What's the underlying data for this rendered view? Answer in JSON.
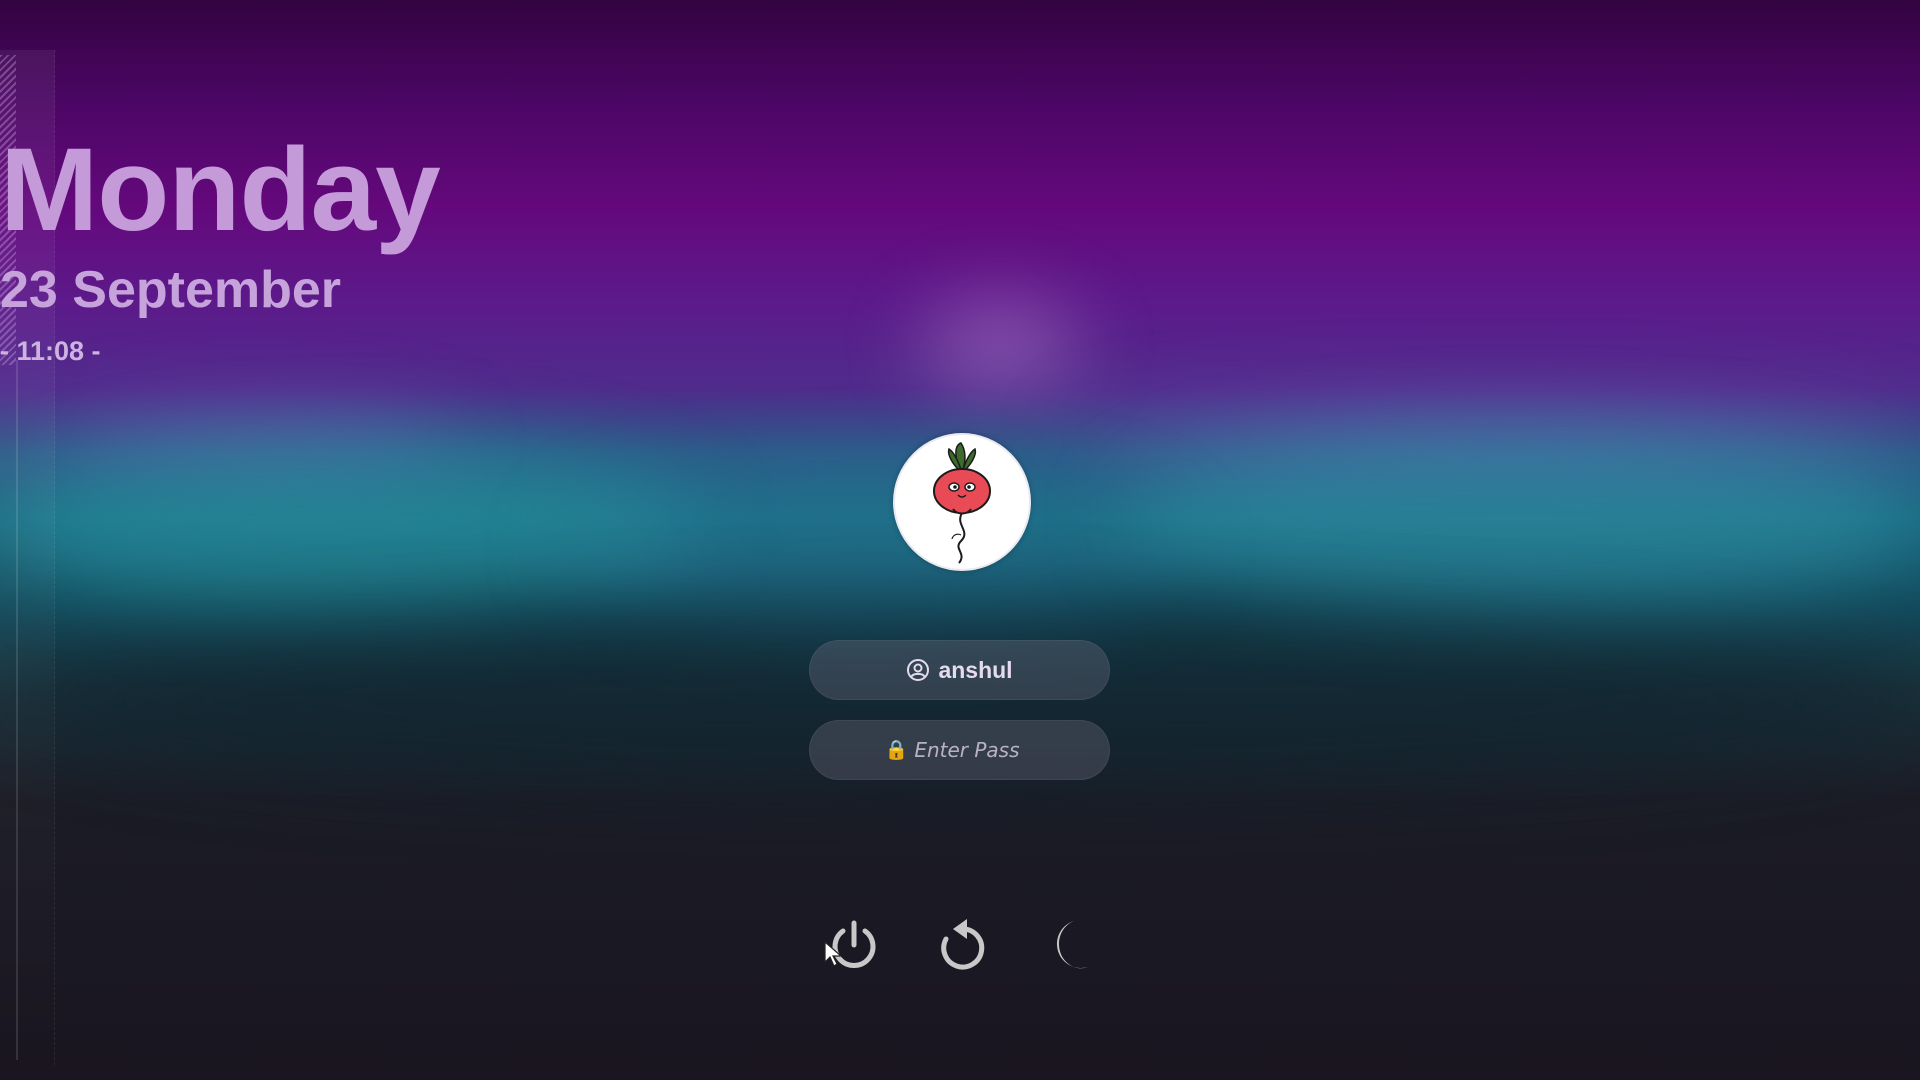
{
  "clock": {
    "day": "Monday",
    "date": "23 September",
    "time": "- 11:08 -"
  },
  "user": {
    "avatar_icon": "radish-avatar-icon",
    "user_icon": "user-circle-icon",
    "name": "anshul"
  },
  "password": {
    "lock_icon": "🔒",
    "placeholder": "Enter Pass",
    "value": ""
  },
  "power_actions": [
    {
      "name": "power-icon"
    },
    {
      "name": "reboot-icon"
    },
    {
      "name": "sleep-moon-icon"
    }
  ],
  "colors": {
    "title_text": "#c49ad9",
    "background_top": "#330340",
    "background_bottom": "#1a1520",
    "pill_bg": "rgba(120,115,135,0.32)",
    "icon_gray": "#c8c8c8"
  }
}
